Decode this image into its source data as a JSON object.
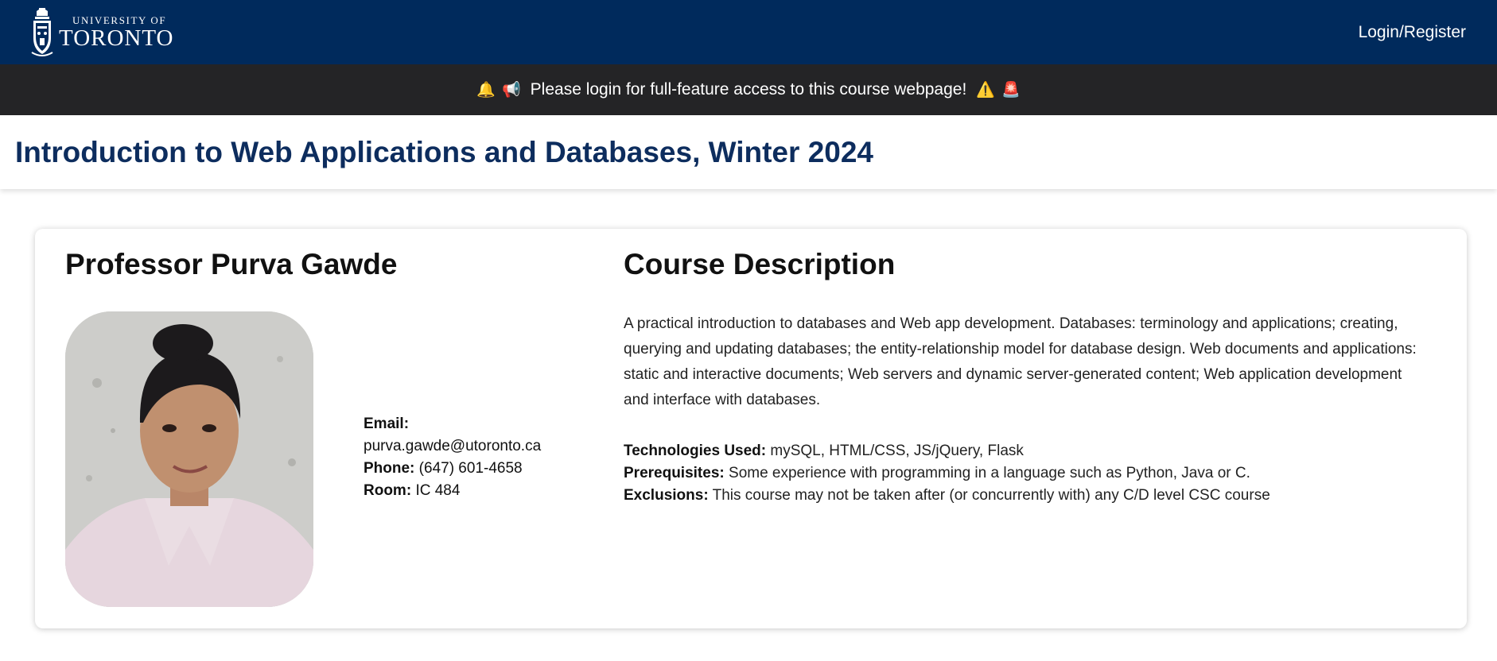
{
  "header": {
    "logo_small": "UNIVERSITY OF",
    "logo_big": "TORONTO",
    "login_label": "Login/Register"
  },
  "banner": {
    "text": "Please login for full-feature access to this course webpage!",
    "emoji_left_1": "🔔",
    "emoji_left_2": "📢",
    "emoji_right_1": "⚠️",
    "emoji_right_2": "🚨"
  },
  "page": {
    "title": "Introduction to Web Applications and Databases, Winter 2024"
  },
  "professor": {
    "name": "Professor Purva Gawde",
    "email_label": "Email:",
    "email": "purva.gawde@utoronto.ca",
    "phone_label": "Phone:",
    "phone": "(647) 601-4658",
    "room_label": "Room:",
    "room": "IC 484"
  },
  "course": {
    "heading": "Course Description",
    "description": "A practical introduction to databases and Web app development. Databases: terminology and applications; creating, querying and updating databases; the entity-relationship model for database design. Web documents and applications: static and interactive documents; Web servers and dynamic server-generated content; Web application development and interface with databases.",
    "tech_label": "Technologies Used:",
    "tech": "mySQL, HTML/CSS, JS/jQuery, Flask",
    "prereq_label": "Prerequisites:",
    "prereq": "Some experience with programming in a language such as Python, Java or C.",
    "excl_label": "Exclusions:",
    "excl": "This course may not be taken after (or concurrently with) any C/D level CSC course"
  },
  "colors": {
    "header_bg": "#002a5c",
    "banner_bg": "#242426",
    "title_color": "#0d2d5e"
  }
}
